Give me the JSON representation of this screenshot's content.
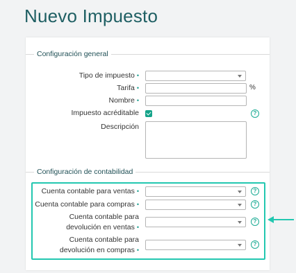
{
  "page": {
    "title": "Nuevo Impuesto"
  },
  "general": {
    "legend": "Configuración general",
    "tipo_label": "Tipo de impuesto",
    "tarifa_label": "Tarifa",
    "tarifa_unit": "%",
    "nombre_label": "Nombre",
    "acreditable_label": "Impuesto acréditable",
    "acreditable_checked": true,
    "descripcion_label": "Descripción"
  },
  "contabilidad": {
    "legend": "Configuración de contabilidad",
    "ventas_label": "Cuenta contable para ventas",
    "compras_label": "Cuenta contable para compras",
    "dev_ventas_line1": "Cuenta contable para",
    "dev_ventas_line2": "devolución en ventas",
    "dev_compras_line1": "Cuenta contable para",
    "dev_compras_line2": "devolución en compras"
  },
  "common": {
    "required_mark": "•",
    "help_glyph": "?"
  },
  "colors": {
    "accent": "#22c7b0",
    "title": "#1f5f63",
    "checkbox": "#15a389"
  }
}
